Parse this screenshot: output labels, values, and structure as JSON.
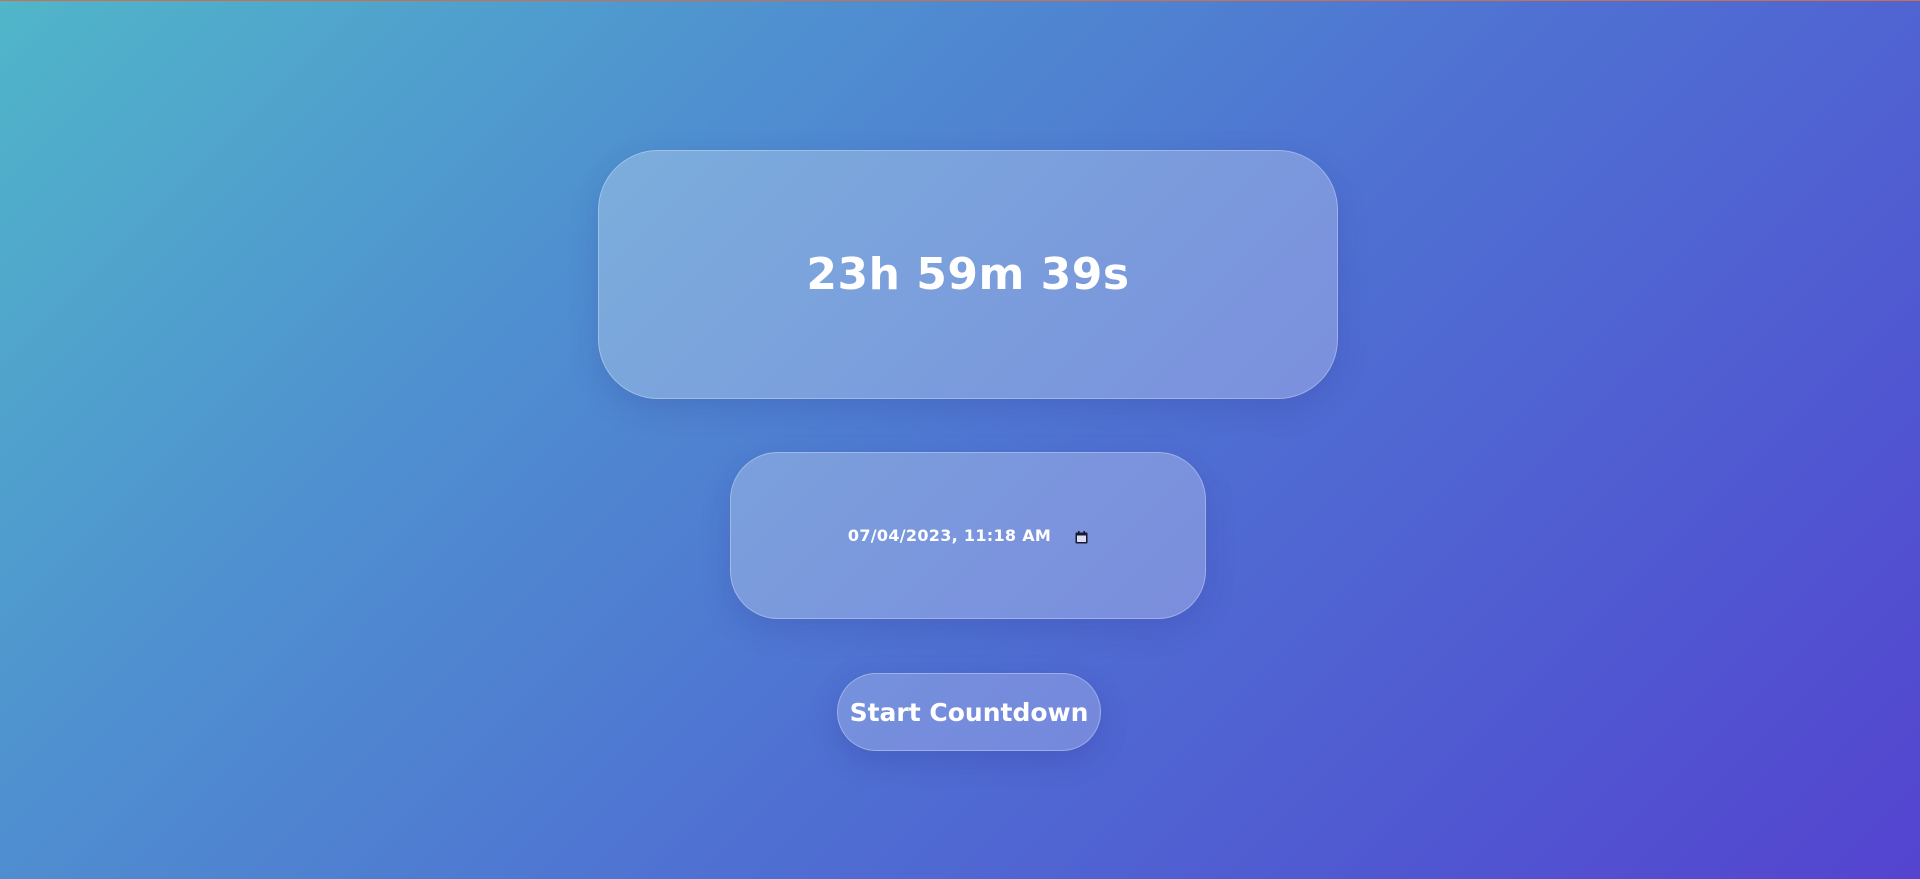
{
  "timer": {
    "display": "23h 59m 39s"
  },
  "target_input": {
    "value": "07/04/2023, 11:18 AM",
    "icon": "calendar-icon"
  },
  "actions": {
    "start_label": "Start Countdown"
  },
  "colors": {
    "gradient_start": "#50b6c9",
    "gradient_end": "#5444d0",
    "text": "#ffffff"
  }
}
